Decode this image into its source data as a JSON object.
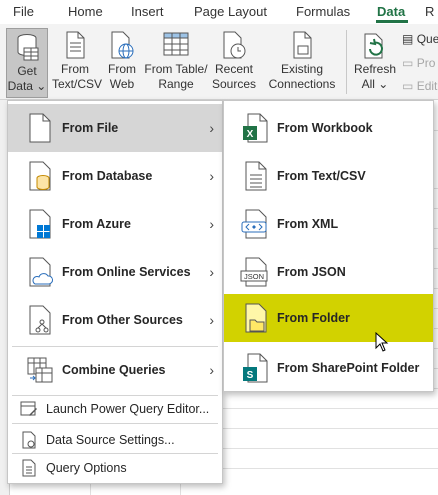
{
  "ribbon_tabs": [
    "File",
    "Home",
    "Insert",
    "Page Layout",
    "Formulas",
    "Data",
    "R"
  ],
  "active_tab": "Data",
  "ribbon": {
    "get_data": [
      "Get",
      "Data ⌄"
    ],
    "from_text_csv": [
      "From",
      "Text/CSV"
    ],
    "from_web": [
      "From",
      "Web"
    ],
    "from_table_range": [
      "From Table/",
      "Range"
    ],
    "recent_sources": [
      "Recent",
      "Sources"
    ],
    "existing_connections": [
      "Existing",
      "Connections"
    ],
    "refresh_all": [
      "Refresh",
      "All ⌄"
    ],
    "queries_label": "Que",
    "properties_label": "Pro",
    "edit_links_label": "Edit"
  },
  "menu": {
    "items": [
      {
        "label": "From File",
        "icon": "file-icon",
        "hover": true
      },
      {
        "label": "From Database",
        "icon": "database-icon"
      },
      {
        "label": "From Azure",
        "icon": "azure-icon"
      },
      {
        "label": "From Online Services",
        "icon": "cloud-icon"
      },
      {
        "label": "From Other Sources",
        "icon": "other-sources-icon"
      },
      {
        "label": "Combine Queries",
        "icon": "combine-queries-icon"
      }
    ],
    "secondary": [
      {
        "label": "Launch Power Query Editor...",
        "icon": "power-query-editor-icon"
      },
      {
        "label": "Data Source Settings...",
        "icon": "data-source-settings-icon"
      },
      {
        "label": "Query Options",
        "icon": "query-options-icon"
      }
    ]
  },
  "submenu": {
    "items": [
      {
        "label": "From Workbook",
        "icon": "excel-workbook-icon"
      },
      {
        "label": "From Text/CSV",
        "icon": "text-file-icon"
      },
      {
        "label": "From XML",
        "icon": "xml-icon"
      },
      {
        "label": "From JSON",
        "icon": "json-icon"
      },
      {
        "label": "From Folder",
        "icon": "folder-icon",
        "highlight": true
      },
      {
        "label": "From SharePoint Folder",
        "icon": "sharepoint-icon"
      }
    ]
  },
  "colors": {
    "accent": "#217346",
    "hover": "#d6d6d6",
    "highlight": "#d2d200",
    "menu_border": "#c6c6c6"
  }
}
